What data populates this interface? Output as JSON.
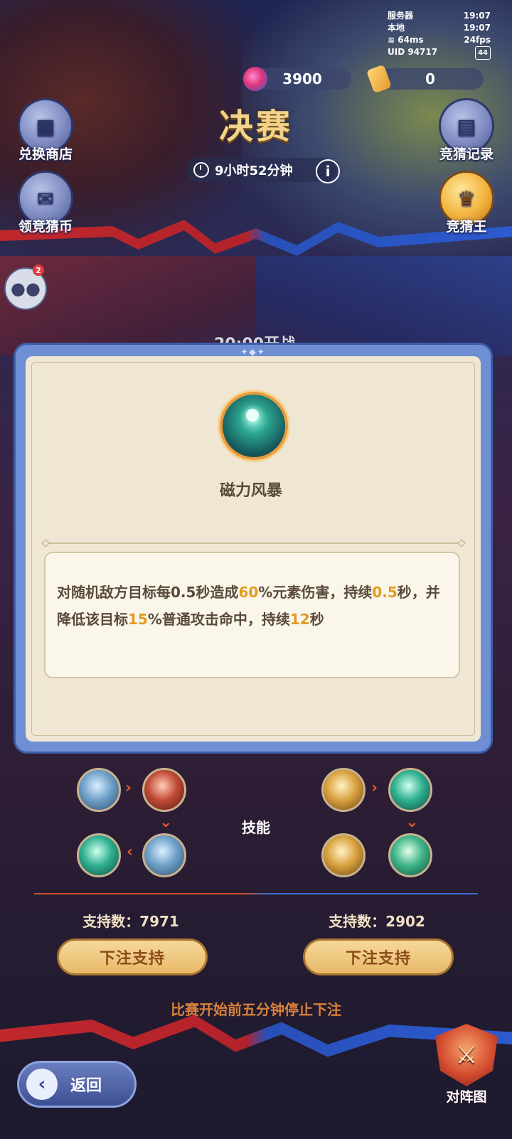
{
  "status_bar": {
    "server_label": "服务器",
    "server_time": "19:07",
    "local_label": "本地",
    "local_time": "19:07",
    "ping": "64ms",
    "fps": "24fps",
    "uid": "UID 94717",
    "battery": "44"
  },
  "currency": {
    "gems": "3900",
    "tickets": "0"
  },
  "side_left": {
    "exchange_shop": "兑换商店",
    "get_coins": "领竞猜币"
  },
  "side_right": {
    "bet_records": "竞猜记录",
    "guess_king": "竞猜王"
  },
  "header": {
    "title": "决赛",
    "countdown": "9小时52分钟",
    "info": "i"
  },
  "chat": {
    "badge": "2"
  },
  "match_start": "20:00开战",
  "popup": {
    "skill_name": "磁力风暴",
    "desc_parts": [
      "对随机敌方目标每0.5秒造成",
      "60",
      "%元素伤害，持续",
      "0.5",
      "秒，并降低该目标",
      "15",
      "%普通攻击命中，持续",
      "12",
      "秒"
    ]
  },
  "skills": {
    "label": "技能"
  },
  "left_team": {
    "support": "支持数：7971",
    "bet": "下注支持"
  },
  "right_team": {
    "support": "支持数：2902",
    "bet": "下注支持"
  },
  "notice": "比赛开始前五分钟停止下注",
  "back": "返回",
  "formation": "对阵图",
  "colors": {
    "highlight": "#e19b1f",
    "popup_border": "#6f8fd4",
    "title_gold": "#f3d38a"
  }
}
